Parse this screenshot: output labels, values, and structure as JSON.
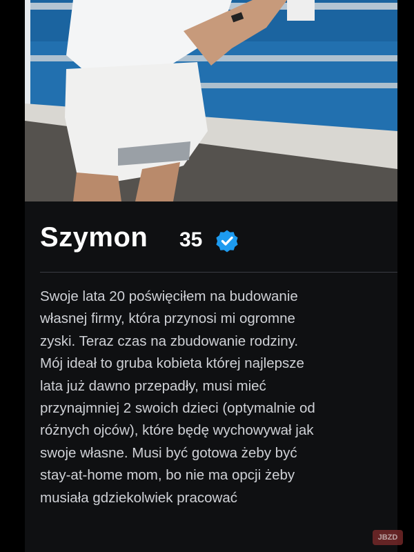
{
  "profile": {
    "name": "Szymon",
    "age": "35",
    "verified_icon": "verified-check-icon",
    "bio": "Swoje lata 20 poświęciłem na budowanie\nwłasnej firmy, która przynosi mi ogromne\nzyski. Teraz czas na zbudowanie rodziny.\nMój ideał to gruba kobieta której najlepsze\nlata już dawno przepadły, musi mieć\nprzynajmniej 2 swoich dzieci (optymalnie od\nróżnych ojców), które będę wychowywał jak\nswoje własne. Musi być gotowa żeby być\nstay-at-home mom, bo nie ma opcji żeby\nmusiała gdziekolwiek pracować"
  },
  "colors": {
    "background": "#0f1012",
    "accent_verified": "#1d9bf0"
  }
}
